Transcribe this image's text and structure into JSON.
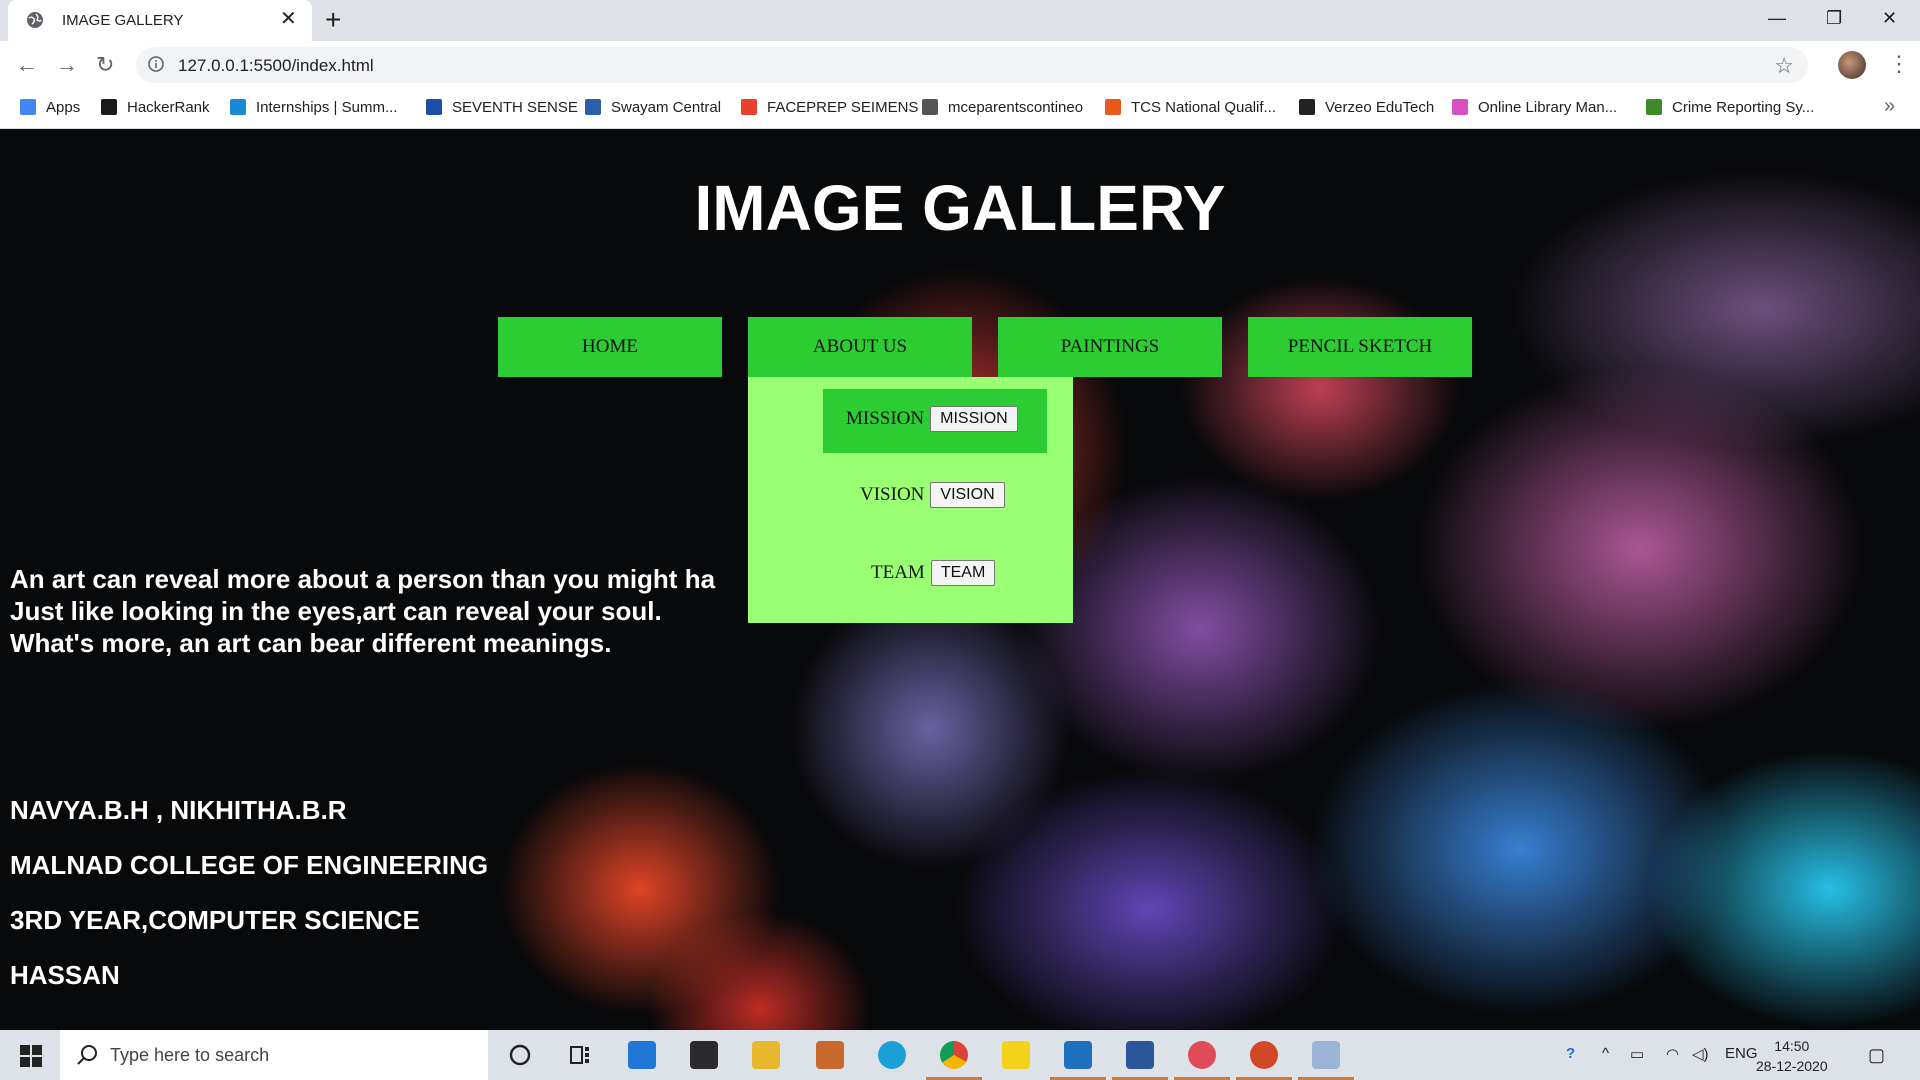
{
  "browser": {
    "tab_title": "IMAGE GALLERY",
    "url": "127.0.0.1:5500/index.html",
    "bookmarks": [
      {
        "label": "Apps",
        "color": "#4285f4"
      },
      {
        "label": "HackerRank",
        "color": "#1a1a1a"
      },
      {
        "label": "Internships | Summ...",
        "color": "#1b8ad6"
      },
      {
        "label": "SEVENTH SENSE",
        "color": "#1a4ea8"
      },
      {
        "label": "Swayam Central",
        "color": "#2a5ea8"
      },
      {
        "label": "FACEPREP SEIMENS",
        "color": "#e8412c"
      },
      {
        "label": "mceparentscontineo",
        "color": "#555555"
      },
      {
        "label": "TCS National Qualif...",
        "color": "#e85a1b"
      },
      {
        "label": "Verzeo EduTech",
        "color": "#222222"
      },
      {
        "label": "Online Library Man...",
        "color": "#d94fc2"
      },
      {
        "label": "Crime Reporting Sy...",
        "color": "#3d8a2a"
      }
    ]
  },
  "page": {
    "title": "IMAGE GALLERY",
    "nav": [
      {
        "label": "HOME"
      },
      {
        "label": "ABOUT US"
      },
      {
        "label": "PAINTINGS"
      },
      {
        "label": "PENCIL SKETCH"
      }
    ],
    "dropdown": [
      {
        "label": "MISSION",
        "button": "MISSION"
      },
      {
        "label": "VISION",
        "button": "VISION"
      },
      {
        "label": "TEAM",
        "button": "TEAM"
      }
    ],
    "intro_lines": [
      "An art can reveal more about a person than you might ha",
      "Just like looking in the eyes,art can reveal your soul.",
      "What's more, an art can bear different meanings."
    ],
    "info_lines": [
      "NAVYA.B.H , NIKHITHA.B.R",
      "MALNAD COLLEGE OF ENGINEERING",
      "3RD YEAR,COMPUTER SCIENCE",
      "HASSAN"
    ]
  },
  "taskbar": {
    "search_placeholder": "Type here to search",
    "language": "ENG",
    "time": "14:50",
    "date": "28-12-2020"
  },
  "colors": {
    "nav_green": "#2ccc33",
    "dropdown_bg": "#99ff73"
  }
}
